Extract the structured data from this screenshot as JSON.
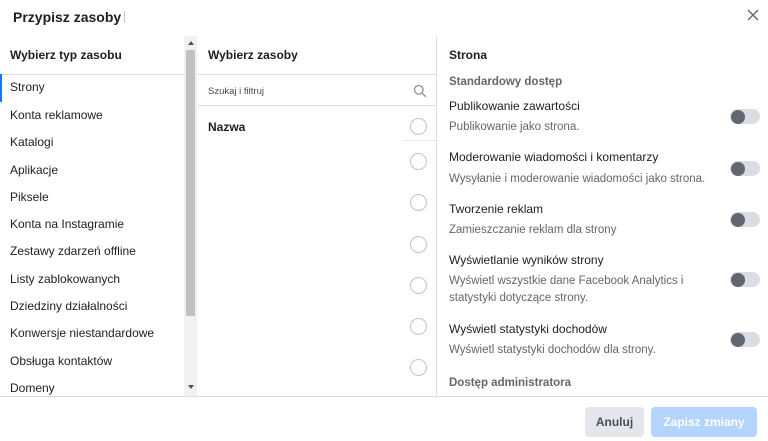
{
  "dialog": {
    "title": "Przypisz zasoby",
    "close_icon": "close-icon"
  },
  "left": {
    "header": "Wybierz typ zasobu",
    "selected_index": 0,
    "accent_color": "#1877f2",
    "items": [
      "Strony",
      "Konta reklamowe",
      "Katalogi",
      "Aplikacje",
      "Piksele",
      "Konta na Instagramie",
      "Zestawy zdarzeń offline",
      "Listy zablokowanych",
      "Dziedziny działalności",
      "Konwersje niestandardowe",
      "Obsługa kontaktów",
      "Domeny"
    ]
  },
  "middle": {
    "header": "Wybierz zasoby",
    "search": {
      "placeholder": "Szukaj i filtruj",
      "value": "",
      "icon": "search-icon"
    },
    "column_header": "Nazwa"
  },
  "right": {
    "header": "Strona",
    "standard_section": "Standardowy dostęp",
    "permissions": [
      {
        "title": "Publikowanie zawartości",
        "desc": "Publikowanie jako strona.",
        "enabled": false
      },
      {
        "title": "Moderowanie wiadomości i komentarzy",
        "desc": "Wysyłanie i moderowanie wiadomości jako strona.",
        "enabled": false
      },
      {
        "title": "Tworzenie reklam",
        "desc": "Zamieszczanie reklam dla strony",
        "enabled": false
      },
      {
        "title": "Wyświetlanie wyników strony",
        "desc": "Wyświetl wszystkie dane Facebook Analytics i statystyki dotyczące strony.",
        "enabled": false
      },
      {
        "title": "Wyświetl statystyki dochodów",
        "desc": "Wyświetl statystyki dochodów dla strony.",
        "enabled": false
      }
    ],
    "admin_section": "Dostęp administratora"
  },
  "footer": {
    "cancel_label": "Anuluj",
    "save_label": "Zapisz zmiany",
    "save_color": "#b3d4fc"
  }
}
